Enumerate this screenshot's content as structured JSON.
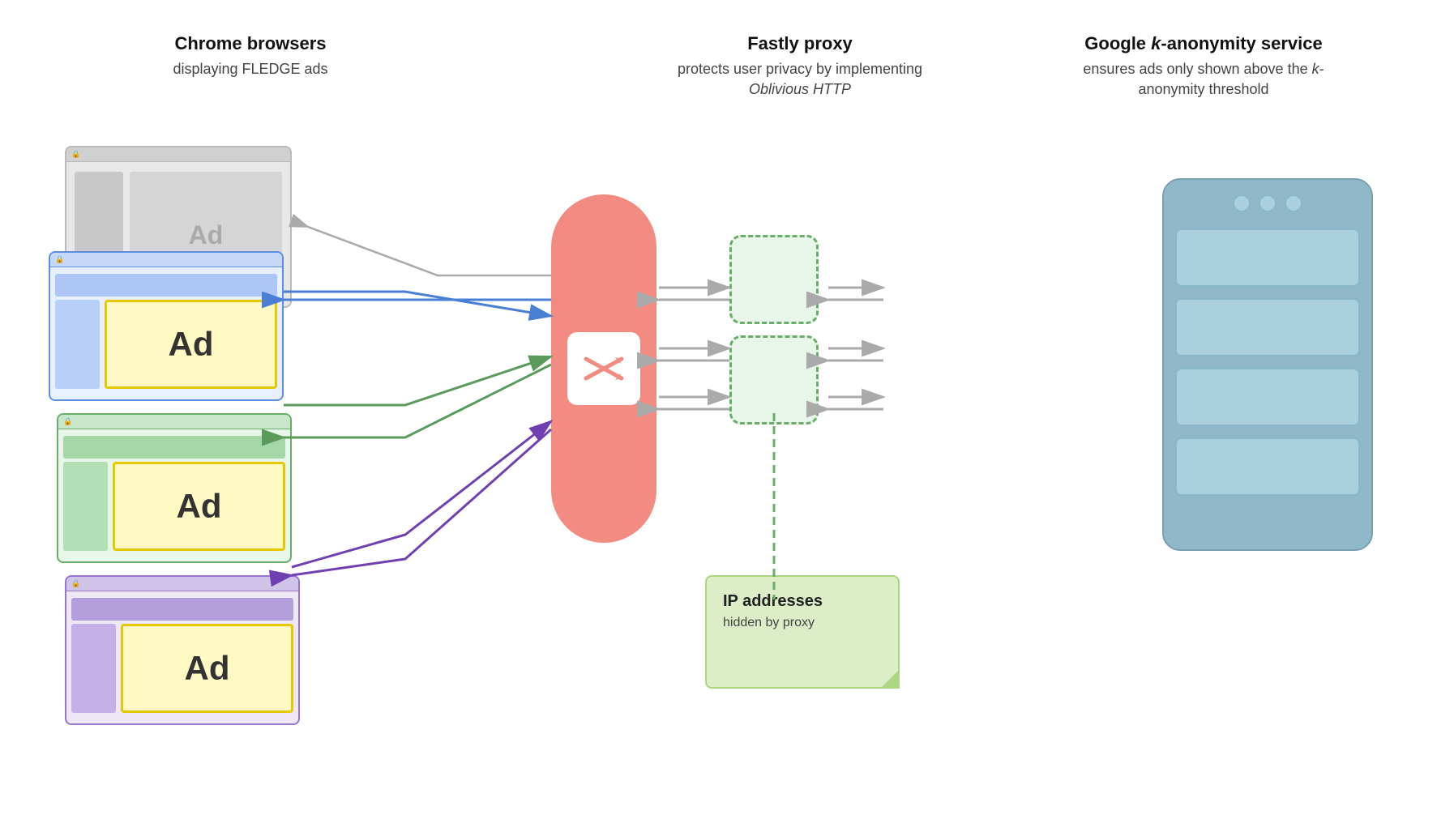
{
  "header": {
    "col1": {
      "title": "Chrome browsers",
      "subtitle": "displaying FLEDGE ads"
    },
    "col2": {
      "title": "Fastly proxy",
      "subtitle_plain": "protects user privacy by implementing ",
      "subtitle_italic": "Oblivious HTTP"
    },
    "col3": {
      "title_plain": "Google ",
      "title_italic": "k",
      "title_after": "-anonymity service",
      "subtitle": "ensures ads only shown above the k-anonymity threshold"
    }
  },
  "browsers": {
    "blue_ad": "Ad",
    "green_ad": "Ad",
    "purple_ad": "Ad",
    "gray_ad": "Ad"
  },
  "proxy": {
    "icon": "⇄"
  },
  "ip_box": {
    "title": "IP addresses",
    "subtitle": "hidden by proxy"
  }
}
